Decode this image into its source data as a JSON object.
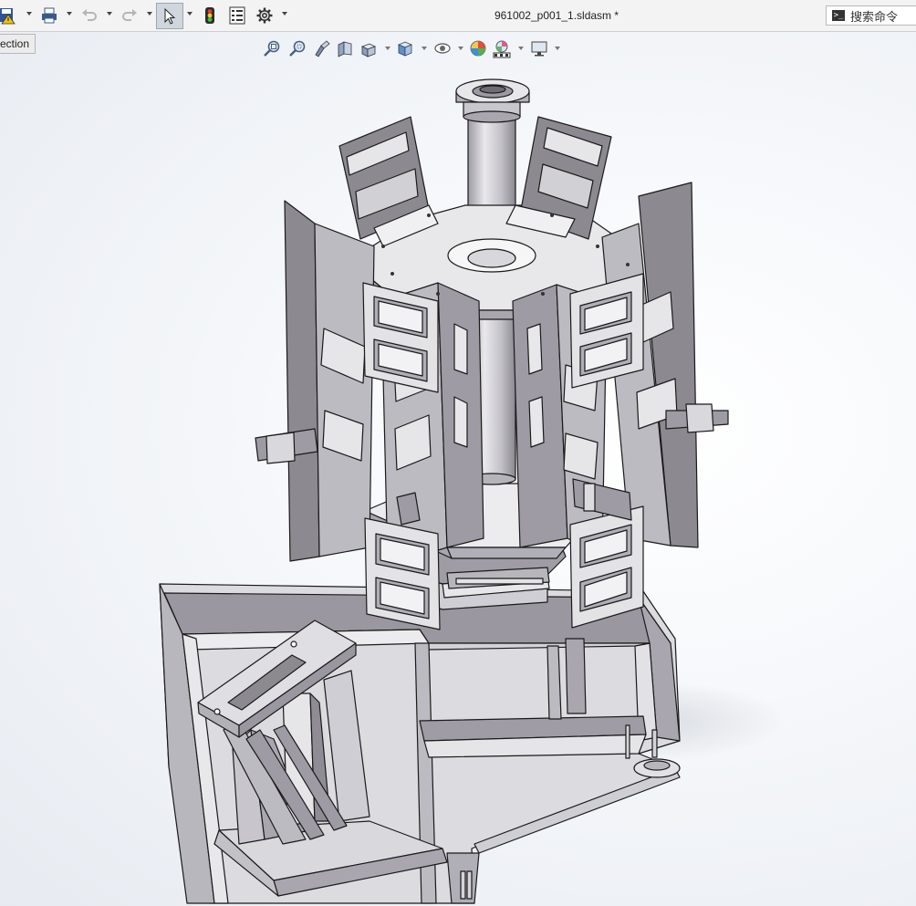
{
  "window": {
    "document_title": "961002_p001_1.sldasm *",
    "search_placeholder": "搜索命令"
  },
  "toolbar": {
    "buttons": [
      {
        "name": "save-icon",
        "has_menu": true
      },
      {
        "name": "print-icon",
        "has_menu": true
      },
      {
        "name": "undo-icon",
        "has_menu": true,
        "disabled": true
      },
      {
        "name": "redo-icon",
        "has_menu": true,
        "disabled": true
      },
      {
        "name": "select-pointer-icon",
        "has_menu": true,
        "active": true
      },
      {
        "name": "rebuild-traffic-light-icon",
        "has_menu": false
      },
      {
        "name": "file-properties-icon",
        "has_menu": false
      },
      {
        "name": "options-gear-icon",
        "has_menu": true
      }
    ]
  },
  "viewport": {
    "tab_label": "ection",
    "heads_up_toolbar": [
      "zoom-to-fit-icon",
      "zoom-to-area-icon",
      "previous-view-icon",
      "section-view-icon",
      "dynamic-annotation-icon",
      "view-orientation-icon",
      "display-style-icon",
      "hide-show-items-icon",
      "edit-appearance-icon",
      "apply-scene-icon",
      "view-settings-icon"
    ]
  },
  "colors": {
    "toolbar_bg": "#f3f3f3",
    "viewport_bg": "#e7ebf1",
    "part_light": "#e6e6e9",
    "part_mid": "#b8b6be",
    "part_dark": "#8c8991",
    "edge": "#1a1a1a"
  }
}
